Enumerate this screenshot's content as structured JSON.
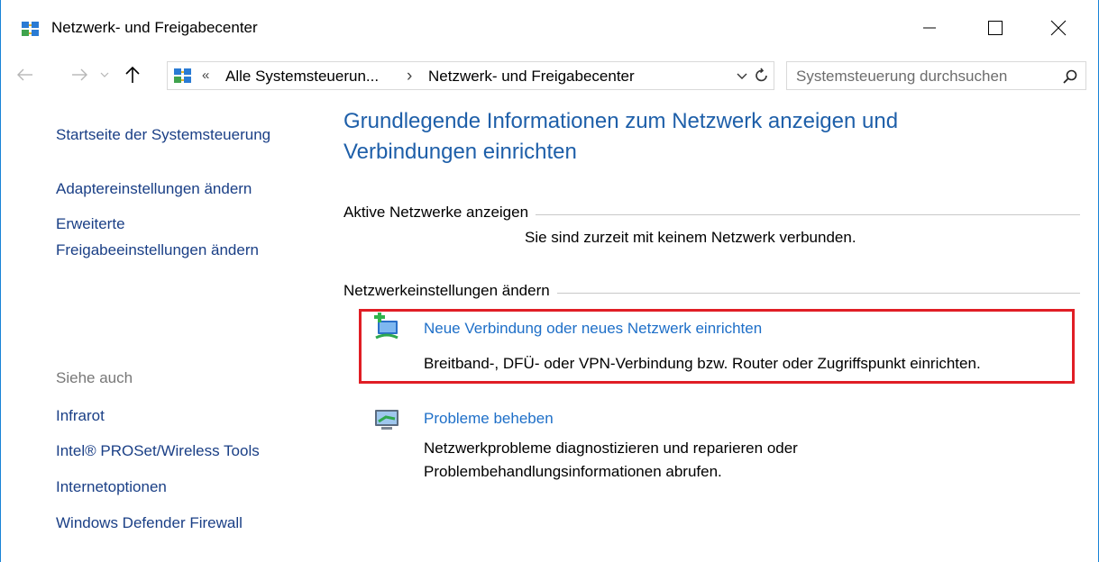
{
  "window": {
    "title": "Netzwerk- und Freigabecenter"
  },
  "address": {
    "overflow": "«",
    "segments": [
      "Alle Systemsteuerun...",
      "Netzwerk- und Freigabecenter"
    ],
    "separator": "›"
  },
  "search": {
    "placeholder": "Systemsteuerung durchsuchen"
  },
  "sidebar": {
    "home": "Startseite der Systemsteuerung",
    "links": [
      "Adaptereinstellungen ändern",
      "Erweiterte",
      "Freigabeeinstellungen ändern"
    ],
    "see_also_heading": "Siehe auch",
    "see_also": [
      "Infrarot",
      "Intel® PROSet/Wireless Tools",
      "Internetoptionen",
      "Windows Defender Firewall"
    ]
  },
  "main": {
    "title_line1": "Grundlegende Informationen zum Netzwerk anzeigen und",
    "title_line2": "Verbindungen einrichten",
    "active_networks_label": "Aktive Netzwerke anzeigen",
    "active_networks_status": "Sie sind zurzeit mit keinem Netzwerk verbunden.",
    "change_settings_label": "Netzwerkeinstellungen ändern",
    "tasks": [
      {
        "icon": "new-connection-icon",
        "link": "Neue Verbindung oder neues Netzwerk einrichten",
        "desc_line1": "Breitband-, DFÜ- oder VPN-Verbindung bzw. Router oder Zugriffspunkt einrichten."
      },
      {
        "icon": "troubleshoot-icon",
        "link": "Probleme beheben",
        "desc_line1": "Netzwerkprobleme diagnostizieren und reparieren oder",
        "desc_line2": "Problembehandlungsinformationen abrufen."
      }
    ]
  },
  "colors": {
    "accent_link": "#1e6fc8",
    "title_blue": "#1e5fa9",
    "highlight_border": "#e01e25",
    "window_border": "#1883d7"
  }
}
